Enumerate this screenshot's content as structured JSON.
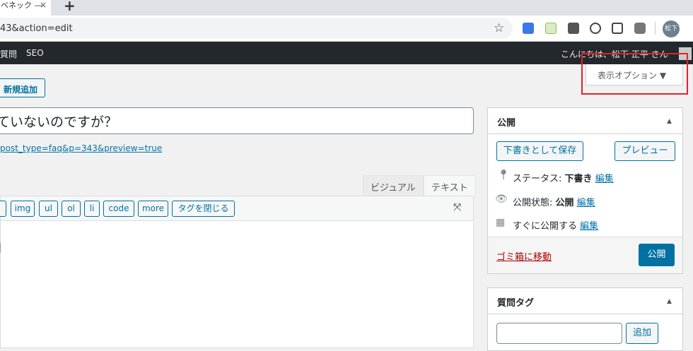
{
  "browser": {
    "tab_title": "ベネック —",
    "tab_close": "×",
    "new_tab": "+",
    "url": "43&action=edit",
    "profile_label": "松下"
  },
  "adminbar": {
    "items": [
      "質問",
      "SEO"
    ],
    "greeting": "こんにちは、松下 正平 さん"
  },
  "screen_options": {
    "label": "表示オプション ▼"
  },
  "page": {
    "add_new_label": "新規追加",
    "post_title": "ていないのですが？",
    "permalink": "post_type=faq&p=343&preview=true"
  },
  "editor": {
    "tabs": [
      "ビジュアル",
      "テキスト"
    ],
    "quicktags": [
      "",
      "img",
      "ul",
      "ol",
      "li",
      "code",
      "more",
      "タグを閉じる"
    ]
  },
  "publish": {
    "heading": "公開",
    "save_draft": "下書きとして保存",
    "preview": "プレビュー",
    "status_label": "ステータス:",
    "status_value": "下書き",
    "visibility_label": "公開状態:",
    "visibility_value": "公開",
    "schedule_label": "すぐに公開する",
    "edit_link": "編集",
    "trash": "ゴミ箱に移動",
    "publish_button": "公開"
  },
  "tags": {
    "heading": "質問タグ",
    "add_button": "追加"
  },
  "colors": {
    "accent": "#0071a1",
    "adminbar": "#23282d",
    "highlight_box": "#e0232b"
  }
}
